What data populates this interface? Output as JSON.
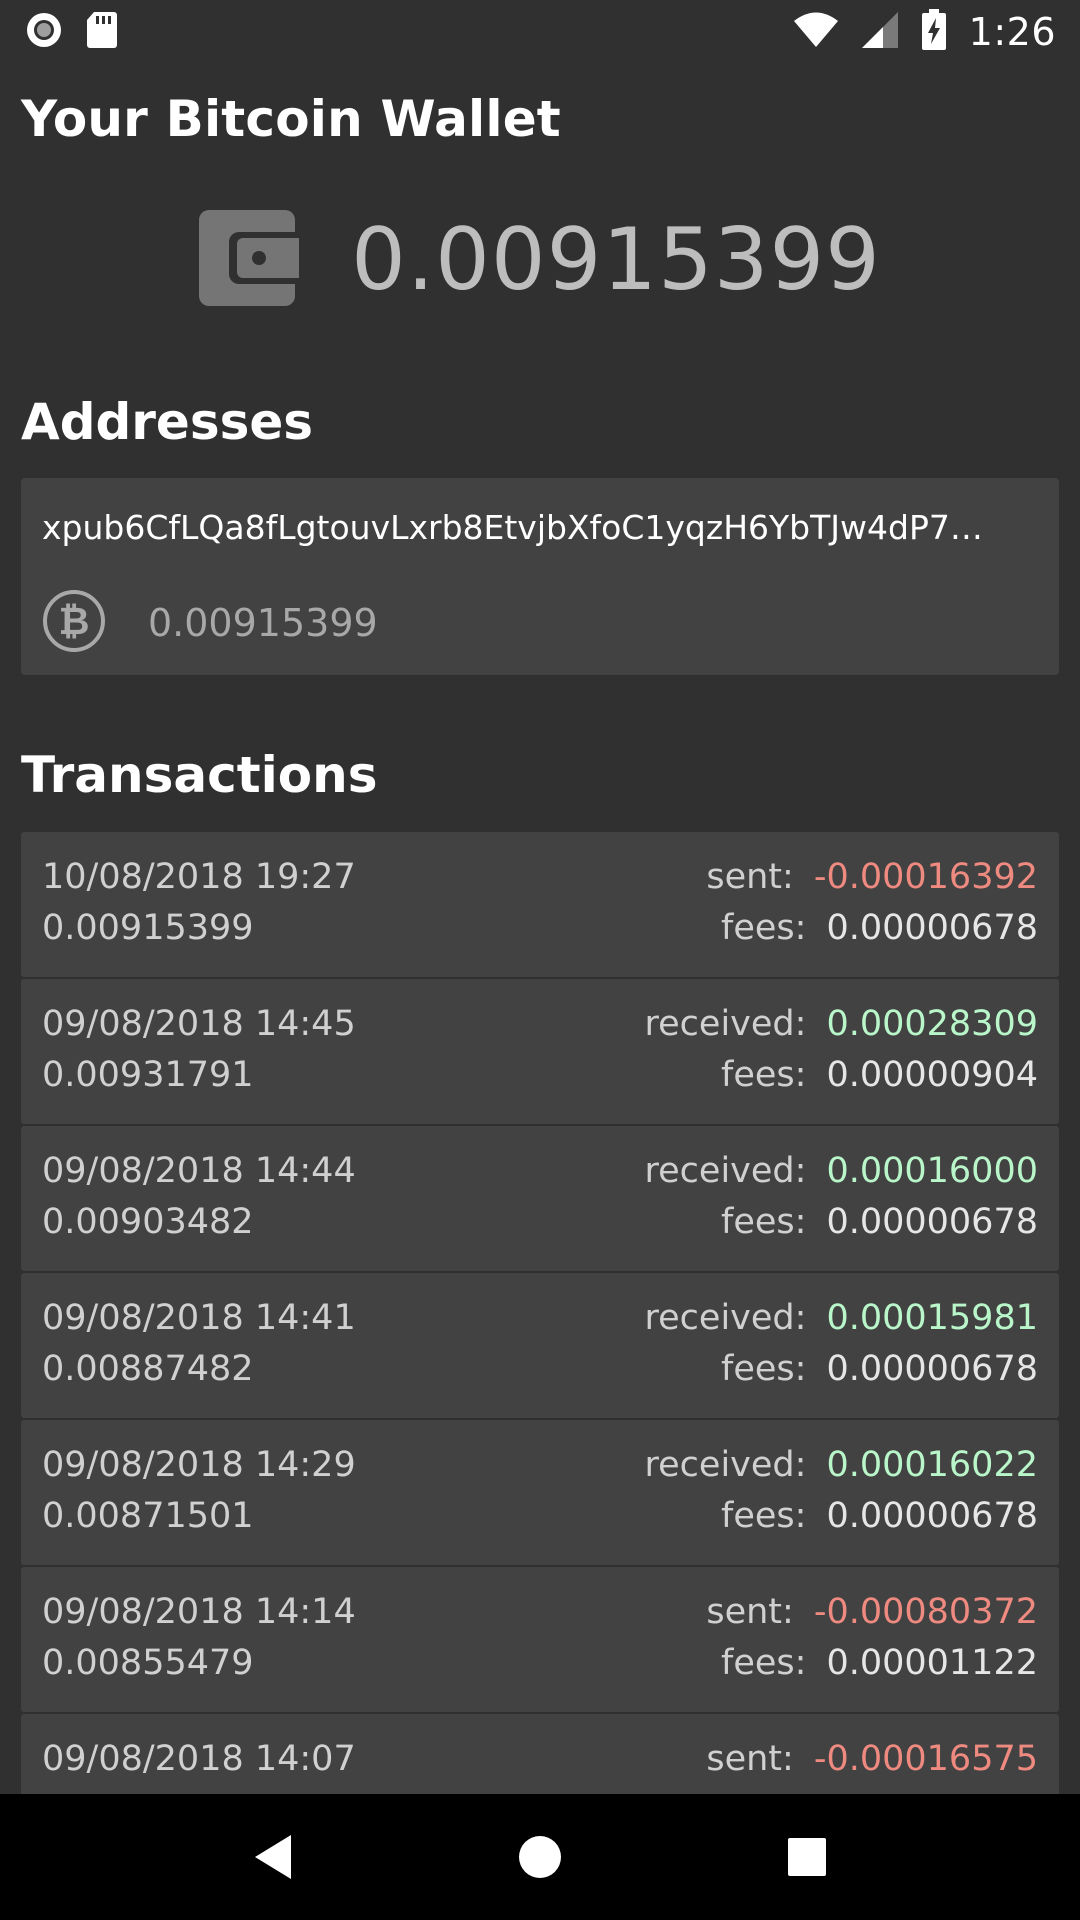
{
  "status_bar": {
    "time": "1:26",
    "left_icons": [
      "record-icon",
      "sd-card-icon"
    ],
    "right_icons": [
      "wifi-icon",
      "signal-icon",
      "battery-charging-icon"
    ]
  },
  "header": {
    "title": "Your Bitcoin Wallet"
  },
  "balance": {
    "icon": "wallet-icon",
    "value": "0.00915399",
    "color": "#bdbdbd"
  },
  "addresses": {
    "heading": "Addresses",
    "items": [
      {
        "id": "xpub6CfLQa8fLgtouvLxrb8EtvjbXfoC1yqzH6YbTJw4dP7…",
        "icon": "bitcoin-icon",
        "balance": "0.00915399"
      }
    ]
  },
  "transactions": {
    "heading": "Transactions",
    "items": [
      {
        "datetime": "10/08/2018 19:27",
        "balance": "0.00915399",
        "type_label": "sent:",
        "type": "sent",
        "amount": "-0.00016392",
        "fees_label": "fees:",
        "fees": "0.00000678"
      },
      {
        "datetime": "09/08/2018 14:45",
        "balance": "0.00931791",
        "type_label": "received:",
        "type": "received",
        "amount": "0.00028309",
        "fees_label": "fees:",
        "fees": "0.00000904"
      },
      {
        "datetime": "09/08/2018 14:44",
        "balance": "0.00903482",
        "type_label": "received:",
        "type": "received",
        "amount": "0.00016000",
        "fees_label": "fees:",
        "fees": "0.00000678"
      },
      {
        "datetime": "09/08/2018 14:41",
        "balance": "0.00887482",
        "type_label": "received:",
        "type": "received",
        "amount": "0.00015981",
        "fees_label": "fees:",
        "fees": "0.00000678"
      },
      {
        "datetime": "09/08/2018 14:29",
        "balance": "0.00871501",
        "type_label": "received:",
        "type": "received",
        "amount": "0.00016022",
        "fees_label": "fees:",
        "fees": "0.00000678"
      },
      {
        "datetime": "09/08/2018 14:14",
        "balance": "0.00855479",
        "type_label": "sent:",
        "type": "sent",
        "amount": "-0.00080372",
        "fees_label": "fees:",
        "fees": "0.00001122"
      },
      {
        "datetime": "09/08/2018 14:07",
        "balance": "",
        "type_label": "sent:",
        "type": "sent",
        "amount": "-0.00016575",
        "fees_label": "",
        "fees": ""
      }
    ]
  },
  "colors": {
    "background": "#303030",
    "card": "#424242",
    "sent": "#ef8a80",
    "received": "#b9f6ca",
    "navbar": "#000000"
  },
  "nav_bar": {
    "icons": [
      "back-icon",
      "home-icon",
      "recents-icon"
    ]
  }
}
